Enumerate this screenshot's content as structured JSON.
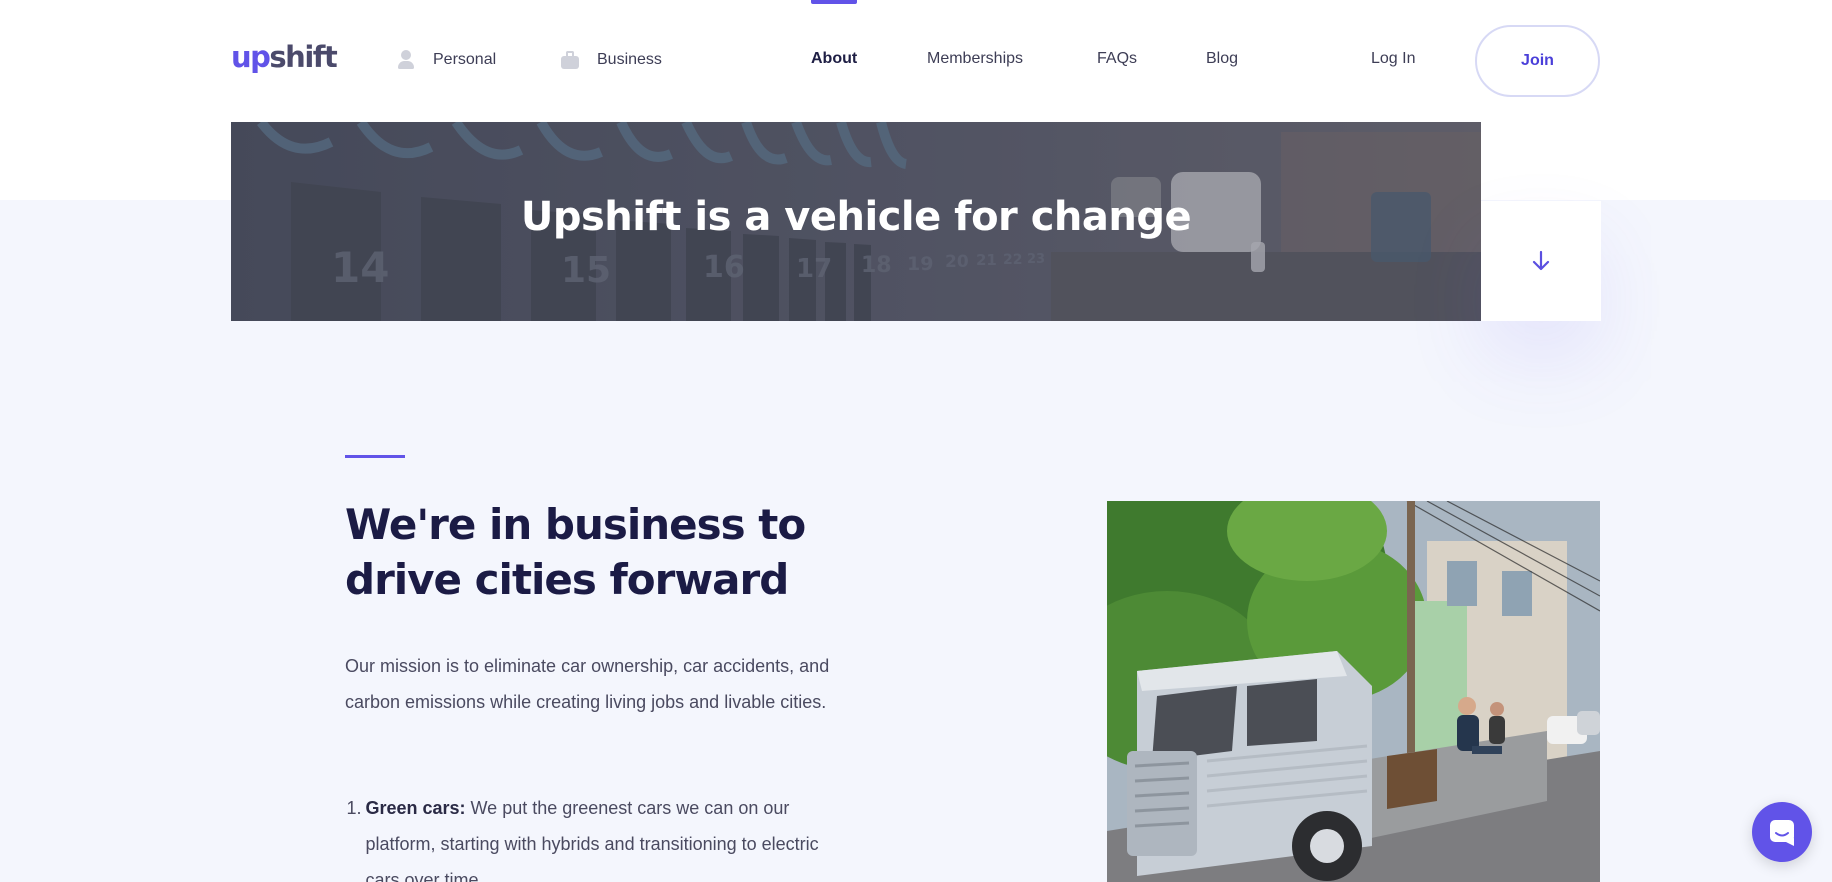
{
  "header": {
    "logo": {
      "part1": "up",
      "part2": "shift"
    },
    "segments": [
      {
        "label": "Personal",
        "icon": "person-icon"
      },
      {
        "label": "Business",
        "icon": "briefcase-icon"
      }
    ],
    "nav": [
      "About",
      "Memberships",
      "FAQs",
      "Blog"
    ],
    "active_nav": "About",
    "login_label": "Log In",
    "join_label": "Join"
  },
  "hero": {
    "title": "Upshift is a vehicle for change",
    "scroll_icon": "arrow-down-icon",
    "bike_numbers": [
      "14",
      "15",
      "16",
      "17",
      "18",
      "19",
      "20",
      "21",
      "22",
      "23"
    ]
  },
  "main": {
    "headline": "We're in business to drive cities forward",
    "mission": "Our mission is to eliminate car ownership, car accidents, and carbon emissions while creating living jobs and livable cities.",
    "list": [
      {
        "number": "1.",
        "strong": "Green cars:",
        "text": " We put the greenest cars we can on our platform, starting with hybrids and transitioning to electric cars over time."
      }
    ]
  },
  "chat": {
    "icon": "chat-icon"
  },
  "colors": {
    "accent": "#6153e8",
    "heading": "#1b1b45",
    "background": "#f4f6fd"
  }
}
